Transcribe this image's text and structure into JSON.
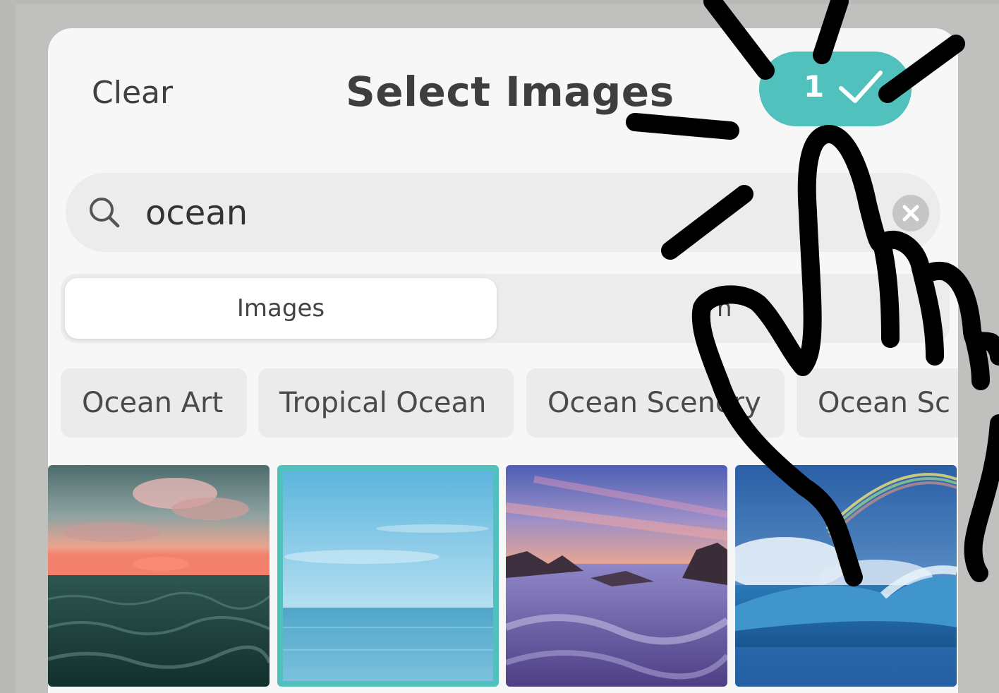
{
  "header": {
    "clear_label": "Clear",
    "title": "Select Images",
    "selected_count": "1"
  },
  "search": {
    "value": "ocean"
  },
  "segments": {
    "first": "Images",
    "second": "n"
  },
  "chips": [
    "Ocean Art",
    "Tropical Ocean",
    "Ocean Scenery",
    "Ocean Sc"
  ],
  "results": [
    {
      "kind": "sunset-sea",
      "selected": false
    },
    {
      "kind": "blue-horizon",
      "selected": true
    },
    {
      "kind": "rocky-shore-dusk",
      "selected": false
    },
    {
      "kind": "rainbow-wave",
      "selected": false
    }
  ],
  "colors": {
    "accent": "#50c1bd",
    "panel": "#f7f7f7",
    "backdrop": "#c0c1be",
    "drawing": "#000000"
  },
  "icons": [
    "search-icon",
    "clear-search-icon",
    "checkmark-icon",
    "pointing-hand-icon"
  ]
}
